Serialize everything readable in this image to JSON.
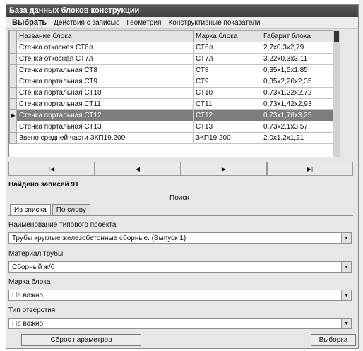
{
  "window": {
    "title": "База данных блоков конструкции"
  },
  "menu": [
    "Выбрать",
    "Действия с записью",
    "Геометрия",
    "Конструктивные показатели"
  ],
  "table": {
    "columns": [
      "Название блока",
      "Марка блока",
      "Габарит блока"
    ],
    "rows": [
      [
        "Стенка откосная СТ6л",
        "СТ6л",
        "2,7x0,3x2,79"
      ],
      [
        "Стенка откосная СТ7л",
        "СТ7л",
        "3,22x0,3x3,11"
      ],
      [
        "Стенка портальная СТ8",
        "СТ8",
        "0,35x1,5x1,85"
      ],
      [
        "Стенка портальная СТ9",
        "СТ9",
        "0,35x2,26x2,35"
      ],
      [
        "Стенка портальная СТ10",
        "СТ10",
        "0,73x1,22x2,72"
      ],
      [
        "Стенка портальная СТ11",
        "СТ11",
        "0,73x1,42x2,93"
      ],
      [
        "Стенка портальная СТ12",
        "СТ12",
        "0,73x1,76x3,25"
      ],
      [
        "Стенка портальная СТ13",
        "СТ13",
        "0,73x2,1x3,57"
      ],
      [
        "Звено средней части ЗКП19.200",
        "ЗКП19.200",
        "2,0x1,2x1,21"
      ]
    ],
    "selected_index": 6
  },
  "navigator": [
    "|◀",
    "◀",
    "▶",
    "▶|"
  ],
  "found_text": "Найдено записей 91",
  "search_caption": "Поиск",
  "tabs": [
    "Из списка",
    "По слову"
  ],
  "fields": [
    {
      "label": "Наименование типового проекта",
      "value": "Трубы круглые железобетонные сборные. (Выпуск 1)"
    },
    {
      "label": "Материал трубы",
      "value": "Сборный ж/б"
    },
    {
      "label": "Марка блока",
      "value": "Не важно"
    },
    {
      "label": "Тип отверстия",
      "value": "Не важно"
    }
  ],
  "buttons": {
    "reset": "Сброс параметров",
    "select": "Выборка"
  },
  "colors": {
    "titlebar": "#4a4a4a",
    "selected_row": "#7d7d7d"
  }
}
